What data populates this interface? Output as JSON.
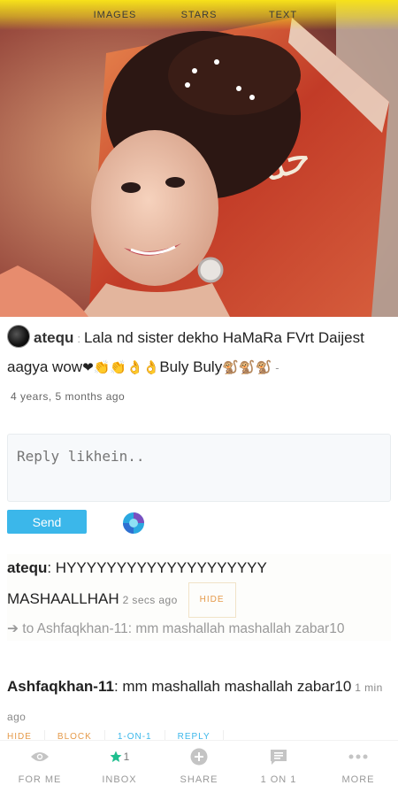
{
  "top_tabs": [
    "IMAGES",
    "STARS",
    "TEXT"
  ],
  "post": {
    "username": "atequ",
    "separator": ":",
    "text_part1": "Lala nd sister dekho HaMaRa FVrt Daijest aagya wow",
    "emojis_mid": "❤👏👏👌👌",
    "text_part2": "Buly Buly",
    "emojis_end": "🐒🐒🐒",
    "trailing": "-",
    "time_ago": "4 years, 5 months ago"
  },
  "reply_box": {
    "placeholder": "Reply likhein.."
  },
  "send_label": "Send",
  "replies": [
    {
      "username": "atequ",
      "text": "HYYYYYYYYYYYYYYYYYYYY MASHAALLHAH",
      "time": "2 secs ago",
      "hide_label": "HIDE",
      "quote": "➔ to Ashfaqkhan-11: mm mashallah mashallah zabar10"
    },
    {
      "username": "Ashfaqkhan-11",
      "text": "mm mashallah mashallah zabar10",
      "time": "1 min ago"
    }
  ],
  "reply_actions": [
    {
      "label": "HIDE",
      "color": "#e59a4a"
    },
    {
      "label": "BLOCK",
      "color": "#e59a4a"
    },
    {
      "label": "1-ON-1",
      "color": "#3bb7ea"
    },
    {
      "label": "REPLY",
      "color": "#3bb7ea"
    }
  ],
  "bottom_nav": [
    {
      "label": "FOR ME",
      "icon": "eye-icon"
    },
    {
      "label": "INBOX",
      "icon": "star-icon",
      "badge": "1"
    },
    {
      "label": "SHARE",
      "icon": "plus-circle-icon"
    },
    {
      "label": "1 ON 1",
      "icon": "chat-icon"
    },
    {
      "label": "MORE",
      "icon": "more-dots-icon"
    }
  ],
  "colors": {
    "accent": "#3bb7ea",
    "tab_bar": "#f7e21a",
    "orange": "#e59a4a",
    "star": "#1fbf8f"
  }
}
